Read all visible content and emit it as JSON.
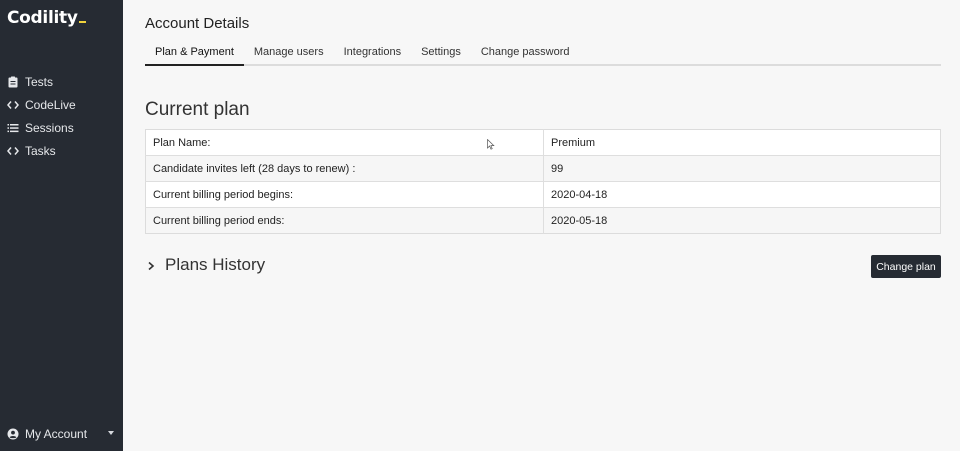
{
  "sidebar": {
    "logo": "Codility",
    "items": [
      {
        "label": "Tests",
        "icon": "clipboard-icon"
      },
      {
        "label": "CodeLive",
        "icon": "code-brackets-icon"
      },
      {
        "label": "Sessions",
        "icon": "list-icon"
      },
      {
        "label": "Tasks",
        "icon": "code-brackets-icon"
      }
    ],
    "account": {
      "label": "My Account",
      "icon": "user-circle-icon"
    }
  },
  "main": {
    "title": "Account Details",
    "tabs": [
      {
        "label": "Plan & Payment",
        "active": true
      },
      {
        "label": "Manage users",
        "active": false
      },
      {
        "label": "Integrations",
        "active": false
      },
      {
        "label": "Settings",
        "active": false
      },
      {
        "label": "Change password",
        "active": false
      }
    ],
    "current_plan": {
      "heading": "Current plan",
      "rows": [
        {
          "label": "Plan Name:",
          "value": "Premium"
        },
        {
          "label": "Candidate invites left (28 days to renew) :",
          "value": "99"
        },
        {
          "label": "Current billing period begins:",
          "value": "2020-04-18"
        },
        {
          "label": "Current billing period ends:",
          "value": "2020-05-18"
        }
      ]
    },
    "plans_history": {
      "label": "Plans History"
    },
    "change_plan_button": "Change plan"
  },
  "colors": {
    "sidebar_bg": "#262b33",
    "logo_accent": "#f0d23c",
    "page_bg": "#f7f7f7",
    "button_bg": "#262b33"
  }
}
